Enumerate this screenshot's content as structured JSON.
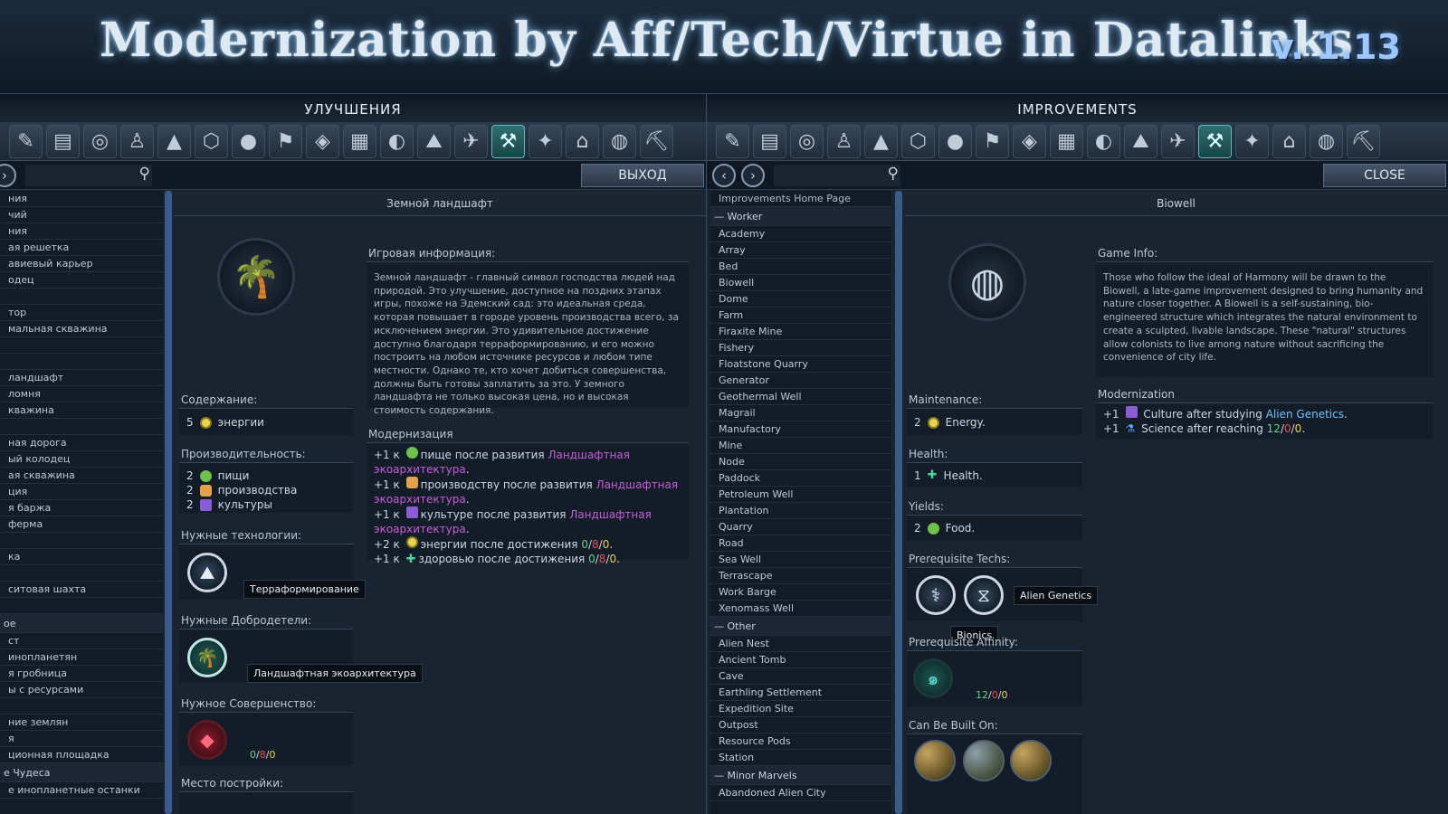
{
  "banner": {
    "title": "Modernization by Aff/Tech/Virtue in Datalinks",
    "version": "v. 1.13"
  },
  "ru": {
    "title": "УЛУЧШЕНИЯ",
    "close": "ВЫХОД",
    "list": [
      {
        "label": "ния"
      },
      {
        "label": "чий"
      },
      {
        "label": "ния"
      },
      {
        "label": "ая решетка"
      },
      {
        "label": "авиевый карьер"
      },
      {
        "label": "одец"
      },
      {
        "label": ""
      },
      {
        "label": "тор"
      },
      {
        "label": "мальная скважина"
      },
      {
        "label": ""
      },
      {
        "label": ""
      },
      {
        "label": " ландшафт"
      },
      {
        "label": "ломня"
      },
      {
        "label": "кважина"
      },
      {
        "label": ""
      },
      {
        "label": "ная дорога"
      },
      {
        "label": "ый колодец"
      },
      {
        "label": "ая скважина"
      },
      {
        "label": "ция"
      },
      {
        "label": "я баржа"
      },
      {
        "label": " ферма"
      },
      {
        "label": ""
      },
      {
        "label": "ка"
      },
      {
        "label": ""
      },
      {
        "label": "ситовая шахта"
      },
      {
        "label": ""
      }
    ],
    "list2": [
      {
        "label": "ое",
        "header": true
      },
      {
        "label": "ст"
      },
      {
        "label": "инопланетян"
      },
      {
        "label": "я гробница"
      },
      {
        "label": "ы с ресурсами"
      },
      {
        "label": ""
      },
      {
        "label": "ние землян"
      },
      {
        "label": "я"
      },
      {
        "label": "ционная площадка"
      },
      {
        "label": "е Чудеса",
        "header": true
      },
      {
        "label": "е инопланетные останки"
      }
    ],
    "content_title": "Земной ландшафт",
    "icon": "palm-island-icon",
    "maintenance_label": "Содержание:",
    "maintenance_value": "5",
    "maintenance_text": "энергии",
    "yields_label": "Производительность:",
    "yields": [
      {
        "value": "2",
        "text": "пищи",
        "icon": "food"
      },
      {
        "value": "2",
        "text": "производства",
        "icon": "production"
      },
      {
        "value": "2",
        "text": "культуры",
        "icon": "culture"
      }
    ],
    "tech_label": "Нужные технологии:",
    "tech_tooltip": "Терраформирование",
    "virtue_label": "Нужные Добродетели:",
    "virtue_tooltip": "Ландшафтная экоархитектура",
    "perfection_label": "Нужное Совершенство:",
    "perfection_values": [
      "0",
      "8",
      "0"
    ],
    "place_label": "Место постройки:",
    "game_info_label": "Игровая информация:",
    "game_info_text": "Земной ландшафт - главный символ господства людей над природой. Это улучшение, доступное на поздних этапах игры, похоже на Эдемский сад: это идеальная среда, которая повышает в городе уровень производства всего, за исключением энергии. Это удивительное достижение доступно благодаря терраформированию, и его можно построить на любом источнике ресурсов и любом типе местности. Однако те, кто хочет добиться совершенства, должны быть готовы заплатить за это. У земного ландшафта не только высокая цена, но и высокая стоимость содержания.",
    "mod_label": "Модернизация",
    "mod": [
      {
        "pre": "+1 к",
        "text": "пище после развития",
        "link": "Ландшафтная экоархитектура",
        "icon": "food"
      },
      {
        "pre": "+1 к",
        "text": "производству после развития",
        "link": "Ландшафтная экоархитектура",
        "icon": "production"
      },
      {
        "pre": "+1 к",
        "text": "культуре после развития",
        "link": "Ландшафтная экоархитектура",
        "icon": "culture"
      },
      {
        "pre": "+2 к",
        "text": "энергии после достижения",
        "icon": "energy"
      },
      {
        "pre": "+1 к",
        "text": "здоровью после достижения",
        "icon": "health"
      }
    ],
    "mod_values": [
      "0",
      "8",
      "0"
    ]
  },
  "en": {
    "title": "IMPROVEMENTS",
    "close": "CLOSE",
    "home": "Improvements Home Page",
    "worker_header": "Worker",
    "worker": [
      "Academy",
      "Array",
      "Bed",
      "Biowell",
      "Dome",
      "Farm",
      "Firaxite Mine",
      "Fishery",
      "Floatstone Quarry",
      "Generator",
      "Geothermal Well",
      "Magrail",
      "Manufactory",
      "Mine",
      "Node",
      "Paddock",
      "Petroleum Well",
      "Plantation",
      "Quarry",
      "Road",
      "Sea Well",
      "Terrascape",
      "Work Barge",
      "Xenomass Well"
    ],
    "other_header": "Other",
    "other": [
      "Alien Nest",
      "Ancient Tomb",
      "Cave",
      "Earthling Settlement",
      "Expedition Site",
      "Outpost",
      "Resource Pods",
      "Station"
    ],
    "minor_header": "Minor Marvels",
    "minor": [
      "Abandoned Alien City"
    ],
    "content_title": "Biowell",
    "icon": "biowell-icon",
    "maintenance_label": "Maintenance:",
    "maintenance_value": "2",
    "maintenance_text": "Energy.",
    "health_label": "Health:",
    "health_value": "1",
    "health_text": "Health.",
    "yields_label": "Yields:",
    "yield_value": "2",
    "yield_text": "Food.",
    "tech_label": "Prerequisite Techs:",
    "tech_tooltip1": "Bionics",
    "tech_tooltip2": "Alien Genetics",
    "affinity_label": "Prerequisite Affinity:",
    "affinity_values": [
      "12",
      "0",
      "0"
    ],
    "built_on_label": "Can Be Built On:",
    "game_info_label": "Game Info:",
    "game_info_text": "Those who follow the ideal of Harmony will be drawn to the Biowell, a late-game improvement designed to bring humanity and nature closer together. A Biowell is a self-sustaining, bio-engineered structure which integrates the natural environment to create a sculpted, livable landscape. These \"natural\" structures allow colonists to live among nature without sacrificing the convenience of city life.",
    "mod_label": "Modernization",
    "mod1_pre": "+1",
    "mod1_text": "Culture after studying",
    "mod1_link": "Alien Genetics",
    "mod1_end": ".",
    "mod2_pre": "+1",
    "mod2_text": "Science after reaching",
    "mod2_values": [
      "12",
      "0",
      "0"
    ],
    "mod2_end": "."
  },
  "category_icons": [
    "scanner-icon",
    "building-icon",
    "globe-shield-icon",
    "person-icon",
    "tent-icon",
    "helmet-icon",
    "sphere-icon",
    "map-icon",
    "satellite-icon",
    "terrain-map-icon",
    "planet-icon",
    "mountain-icon",
    "rover-icon",
    "improvement-icon",
    "aircraft-icon",
    "house-icon",
    "world-icon",
    "pickaxe-icon"
  ],
  "category_glyphs": [
    "✎",
    "▤",
    "◎",
    "♙",
    "▲",
    "⬡",
    "●",
    "⚑",
    "◈",
    "▦",
    "◐",
    "⛰",
    "✈",
    "⚒",
    "✦",
    "⌂",
    "◍",
    "⛏"
  ],
  "colors": {
    "purple_link": "#c35fd9",
    "cyan_link": "#6cc6ff",
    "purity": "#5fd48d",
    "supremacy": "#e0505a",
    "harmony_high": "#e6d64a"
  }
}
